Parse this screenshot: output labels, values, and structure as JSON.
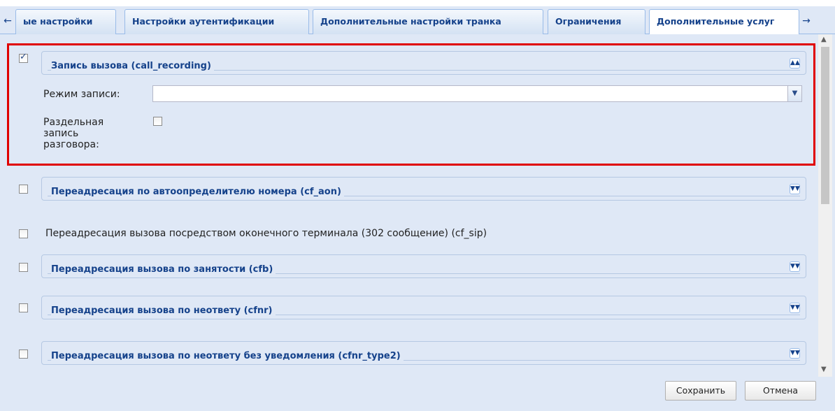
{
  "tabs": {
    "items": [
      {
        "label": "ые настройки"
      },
      {
        "label": "Настройки аутентификации"
      },
      {
        "label": "Дополнительные настройки транка"
      },
      {
        "label": "Ограничения"
      },
      {
        "label": "Дополнительные услуг"
      }
    ],
    "scroll_left_icon": "arrow-left-icon",
    "scroll_right_icon": "arrow-right-icon"
  },
  "expanded_section": {
    "title": "Запись вызова (call_recording)",
    "checked": true,
    "mode_label": "Режим записи:",
    "mode_value": "",
    "split_label": "Раздельная запись разговора:",
    "split_checked": false
  },
  "sections": [
    {
      "title": "Переадресация по автоопределителю номера (cf_aon)",
      "checked": false
    },
    {
      "title": "Переадресация вызова посредством оконечного терминала (302 сообщение) (cf_sip)",
      "checked": false
    },
    {
      "title": "Переадресация вызова по занятости (cfb)",
      "checked": false
    },
    {
      "title": "Переадресация вызова по неответу (cfnr)",
      "checked": false
    },
    {
      "title": "Переадресация вызова по неответу без уведомления (cfnr_type2)",
      "checked": false
    }
  ],
  "buttons": {
    "save": "Сохранить",
    "cancel": "Отмена"
  },
  "colors": {
    "panel_bg": "#dfe8f6",
    "header_text": "#15428b",
    "highlight": "#e00000"
  }
}
